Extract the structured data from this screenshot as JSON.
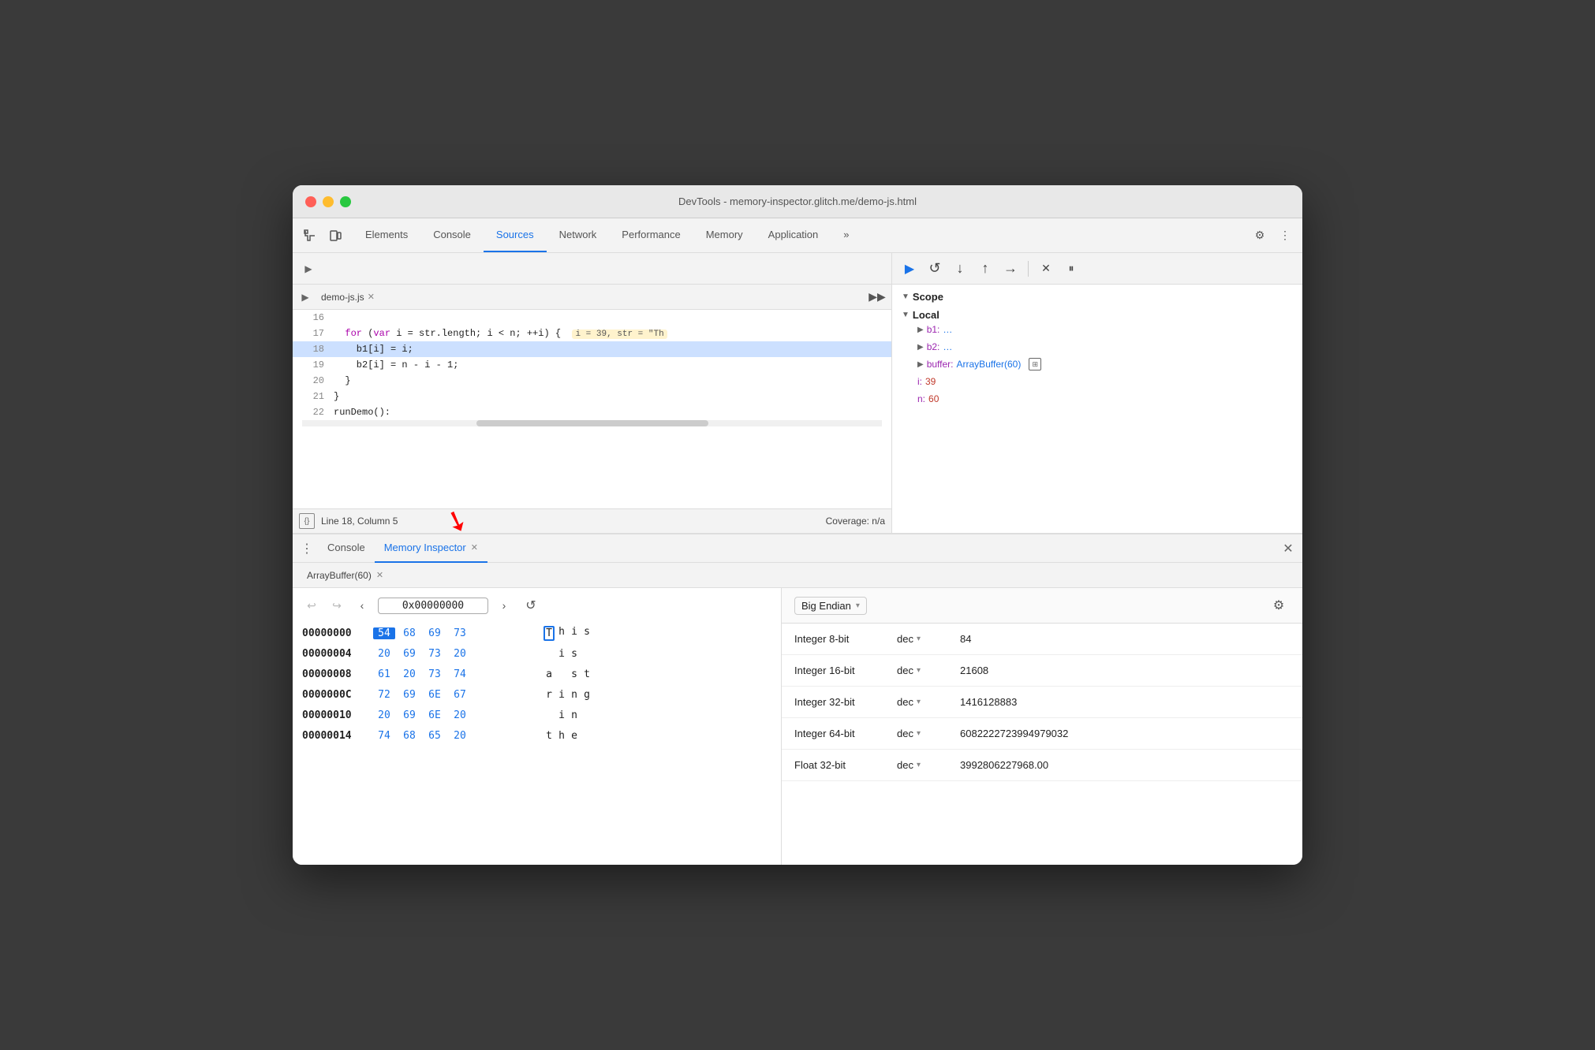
{
  "window": {
    "title": "DevTools - memory-inspector.glitch.me/demo-js.html"
  },
  "devtools_tabs": {
    "items": [
      {
        "label": "Elements",
        "active": false
      },
      {
        "label": "Console",
        "active": false
      },
      {
        "label": "Sources",
        "active": true
      },
      {
        "label": "Network",
        "active": false
      },
      {
        "label": "Performance",
        "active": false
      },
      {
        "label": "Memory",
        "active": false
      },
      {
        "label": "Application",
        "active": false
      }
    ],
    "more_label": "»"
  },
  "source_file": {
    "name": "demo-js.js",
    "icon": "▶"
  },
  "code_lines": [
    {
      "num": "16",
      "text": "",
      "highlighted": false
    },
    {
      "num": "17",
      "text": "  for (var i = str.length; i < n; ++i) {",
      "highlighted": false,
      "inline_val": "i = 39, str = \"Th"
    },
    {
      "num": "18",
      "text": "    b1[i] = i;",
      "highlighted": true,
      "paused": true
    },
    {
      "num": "19",
      "text": "    b2[i] = n - i - 1;",
      "highlighted": false
    },
    {
      "num": "20",
      "text": "  }",
      "highlighted": false
    },
    {
      "num": "21",
      "text": "}",
      "highlighted": false
    },
    {
      "num": "22",
      "text": "runDemo();",
      "highlighted": false
    }
  ],
  "status_bar": {
    "format_label": "{}",
    "position": "Line 18, Column 5",
    "coverage": "Coverage: n/a"
  },
  "bottom_tabs": {
    "items": [
      {
        "label": "Console",
        "active": false
      },
      {
        "label": "Memory Inspector",
        "active": true,
        "closable": true
      }
    ]
  },
  "buffer_tab": {
    "label": "ArrayBuffer(60)"
  },
  "hex_view": {
    "address": "0x00000000",
    "rows": [
      {
        "addr": "00000000",
        "bytes": [
          "54",
          "68",
          "69",
          "73"
        ],
        "chars": [
          "T",
          "h",
          "i",
          "s"
        ],
        "selected_byte": 0
      },
      {
        "addr": "00000004",
        "bytes": [
          "20",
          "69",
          "73",
          "20"
        ],
        "chars": [
          " ",
          "i",
          "s",
          " "
        ]
      },
      {
        "addr": "00000008",
        "bytes": [
          "61",
          "20",
          "73",
          "74"
        ],
        "chars": [
          "a",
          " ",
          "s",
          "t"
        ]
      },
      {
        "addr": "0000000C",
        "bytes": [
          "72",
          "69",
          "6E",
          "67"
        ],
        "chars": [
          "r",
          "i",
          "n",
          "g"
        ]
      },
      {
        "addr": "00000010",
        "bytes": [
          "20",
          "69",
          "6E",
          "20"
        ],
        "chars": [
          " ",
          "i",
          "n",
          " "
        ]
      },
      {
        "addr": "00000014",
        "bytes": [
          "74",
          "68",
          "65",
          "20"
        ],
        "chars": [
          "t",
          "h",
          "e",
          " "
        ]
      }
    ]
  },
  "scope": {
    "header": "Scope",
    "local_section": "Local",
    "items": [
      {
        "key": "b1:",
        "val": "…",
        "expandable": true
      },
      {
        "key": "b2:",
        "val": "…",
        "expandable": true
      },
      {
        "key": "buffer:",
        "val": "ArrayBuffer(60)",
        "expandable": true,
        "has_memory_icon": true
      },
      {
        "key": "i:",
        "val": "39",
        "is_number": true
      },
      {
        "key": "n:",
        "val": "60",
        "is_number": true
      }
    ]
  },
  "data_view": {
    "endian": "Big Endian",
    "rows": [
      {
        "type": "Integer 8-bit",
        "format": "dec",
        "value": "84"
      },
      {
        "type": "Integer 16-bit",
        "format": "dec",
        "value": "21608"
      },
      {
        "type": "Integer 32-bit",
        "format": "dec",
        "value": "1416128883"
      },
      {
        "type": "Integer 64-bit",
        "format": "dec",
        "value": "6082222723994979032"
      },
      {
        "type": "Float 32-bit",
        "format": "dec",
        "value": "3992806227968.00"
      }
    ]
  },
  "debug_buttons": {
    "resume": "▶",
    "step_over": "↩",
    "step_into": "↓",
    "step_out": "↑",
    "step": "→",
    "deactivate": "✕",
    "pause_exceptions": "⏸"
  }
}
